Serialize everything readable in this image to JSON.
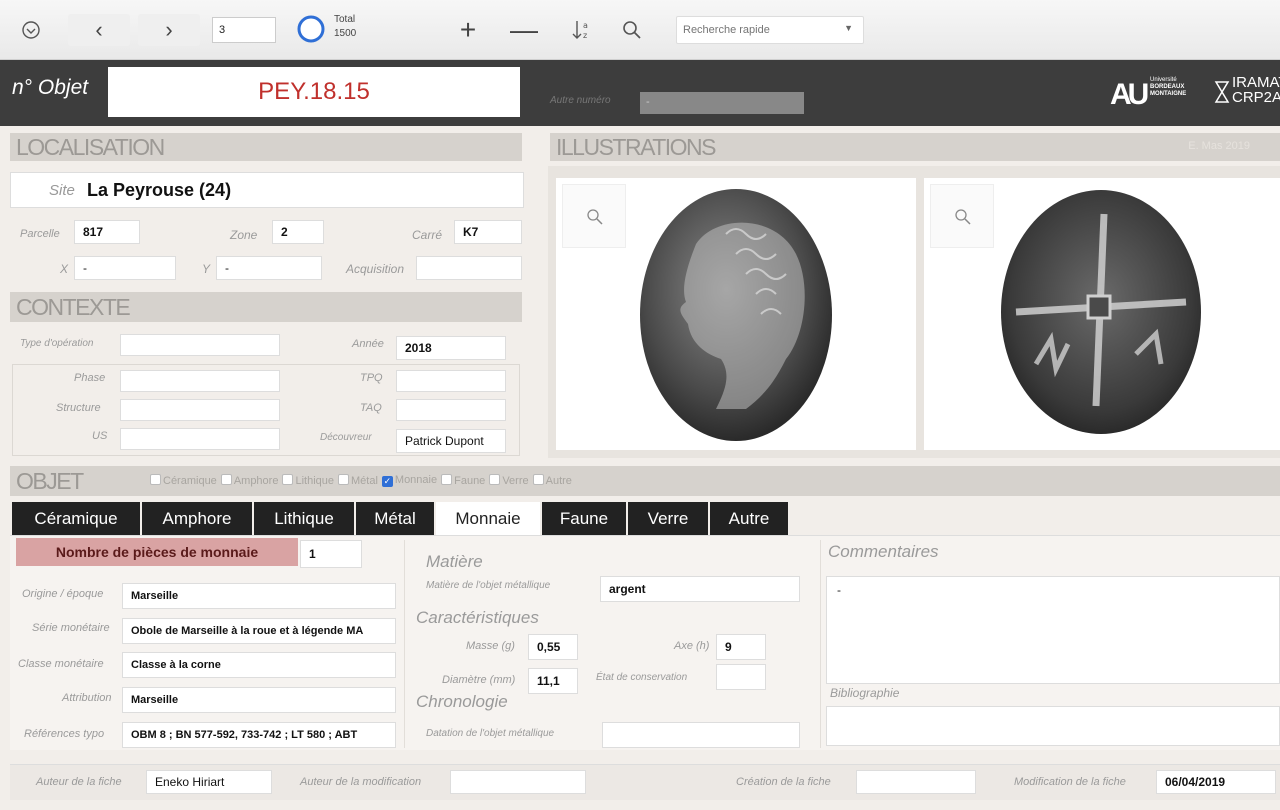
{
  "toolbar": {
    "record_number": "3",
    "total_label": "Total",
    "total_value": "1500",
    "search_placeholder": "Recherche rapide"
  },
  "header": {
    "object_label": "n° Objet",
    "object_value": "PEY.18.15",
    "other_number_label": "Autre numéro",
    "other_number_value": "-",
    "logo_univ_line1": "Université",
    "logo_univ_line2": "BORDEAUX",
    "logo_univ_line3": "MONTAIGNE",
    "logo_iramat_line1": "IRAMAT",
    "logo_iramat_line2": "CRP2A"
  },
  "localisation": {
    "title": "LOCALISATION",
    "site_label": "Site",
    "site_value": "La Peyrouse (24)",
    "parcelle_label": "Parcelle",
    "parcelle_value": "817",
    "zone_label": "Zone",
    "zone_value": "2",
    "carre_label": "Carré",
    "carre_value": "K7",
    "x_label": "X",
    "x_value": "-",
    "y_label": "Y",
    "y_value": "-",
    "acquisition_label": "Acquisition",
    "acquisition_value": ""
  },
  "contexte": {
    "title": "CONTEXTE",
    "type_label": "Type d'opération",
    "annee_label": "Année",
    "annee_value": "2018",
    "phase_label": "Phase",
    "tpq_label": "TPQ",
    "structure_label": "Structure",
    "taq_label": "TAQ",
    "us_label": "US",
    "decouvreur_label": "Découvreur",
    "decouvreur_value": "Patrick Dupont"
  },
  "illustrations": {
    "title": "ILLUSTRATIONS",
    "credit": "E. Mas 2019"
  },
  "objet": {
    "title": "OBJET",
    "categories": [
      "Céramique",
      "Amphore",
      "Lithique",
      "Métal",
      "Monnaie",
      "Faune",
      "Verre",
      "Autre"
    ],
    "checked": "Monnaie"
  },
  "tabs": [
    "Céramique",
    "Amphore",
    "Lithique",
    "Métal",
    "Monnaie",
    "Faune",
    "Verre",
    "Autre"
  ],
  "monnaie": {
    "nb_label": "Nombre de pièces de monnaie",
    "nb_value": "1",
    "origine_label": "Origine / époque",
    "origine_value": "Marseille",
    "serie_label": "Série monétaire",
    "serie_value": "Obole de Marseille à la roue et à légende MA",
    "classe_label": "Classe monétaire",
    "classe_value": "Classe à la corne",
    "attribution_label": "Attribution",
    "attribution_value": "Marseille",
    "references_label": "Références typo",
    "references_value": "OBM 8 ; BN 577-592, 733-742 ; LT 580 ; ABT",
    "matiere_title": "Matière",
    "matiere_label": "Matière de l'objet métallique",
    "matiere_value": "argent",
    "carac_title": "Caractéristiques",
    "masse_label": "Masse (g)",
    "masse_value": "0,55",
    "axe_label": "Axe (h)",
    "axe_value": "9",
    "diametre_label": "Diamètre (mm)",
    "diametre_value": "11,1",
    "etat_label": "État de conservation",
    "etat_value": "",
    "chrono_title": "Chronologie",
    "datation_label": "Datation de l'objet métallique",
    "datation_value": "",
    "commentaires_title": "Commentaires",
    "commentaires_value": "-",
    "biblio_label": "Bibliographie",
    "biblio_value": ""
  },
  "footer": {
    "auteur_label": "Auteur de la fiche",
    "auteur_value": "Eneko Hiriart",
    "auteur_modif_label": "Auteur de la modification",
    "auteur_modif_value": "",
    "creation_label": "Création de la fiche",
    "creation_value": "",
    "modif_label": "Modification de la fiche",
    "modif_value": "06/04/2019"
  }
}
